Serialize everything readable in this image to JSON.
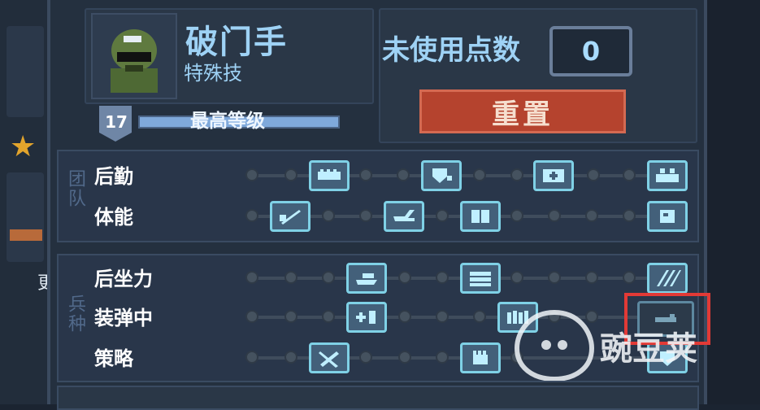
{
  "header": {
    "skill_title": "破门手",
    "skill_subtitle": "特殊技",
    "unused_points_label": "未使用点数",
    "unused_points_value": "0",
    "reset_label": "重置",
    "level_number": "17",
    "level_label": "最高等级"
  },
  "sections": [
    {
      "label": "团队",
      "rows": [
        {
          "label": "后勤"
        },
        {
          "label": "体能"
        }
      ]
    },
    {
      "label": "兵种",
      "rows": [
        {
          "label": "后坐力"
        },
        {
          "label": "装弹中"
        },
        {
          "label": "策略"
        }
      ]
    }
  ],
  "bottom_text": "",
  "left_partial_text": "更",
  "watermark_text": "豌豆荚",
  "colors": {
    "accent_text": "#9ed2f5",
    "reset_button": "#b5432e",
    "highlight_box": "#e23a36",
    "icon_border": "#7fd1e6"
  }
}
